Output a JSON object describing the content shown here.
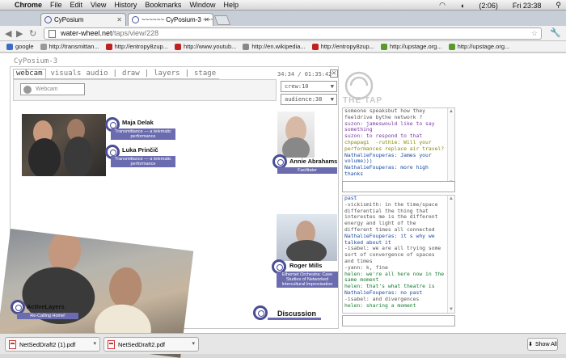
{
  "menubar": {
    "app": "Chrome",
    "items": [
      "File",
      "Edit",
      "View",
      "History",
      "Bookmarks",
      "Window",
      "Help"
    ],
    "battery": "(2:06)",
    "clock": "Fri 23:38"
  },
  "tabs": [
    {
      "title": "CyPosium"
    },
    {
      "title": "~~~~~~ CyPosium-3 ~~~~~~"
    }
  ],
  "toolbar": {
    "url_host": "water-wheel.net",
    "url_path": "/taps/view/228"
  },
  "bookmarks": [
    {
      "label": "google",
      "color": "#3a6cc8"
    },
    {
      "label": "http://transmittan...",
      "color": "#999999"
    },
    {
      "label": "http://entropy8zup...",
      "color": "#c02020"
    },
    {
      "label": "http://www.youtub...",
      "color": "#c02020"
    },
    {
      "label": "http://en.wikipedia...",
      "color": "#888888"
    },
    {
      "label": "http://entropy8zup...",
      "color": "#c02020"
    },
    {
      "label": "http://upstage.org...",
      "color": "#5a9a2a"
    },
    {
      "label": "http://upstage.org...",
      "color": "#5a9a2a"
    }
  ],
  "page": {
    "app_title": "CyPosium-3",
    "stage_tabs": [
      "webcam",
      "visuals",
      "audio",
      "draw",
      "layers",
      "stage"
    ],
    "timer": "34:34 / 01:35:42",
    "webcam_label": "Webcam",
    "crew": "crew:10",
    "audience": "audience:38",
    "brand": "THE TAP"
  },
  "participants": {
    "maja": {
      "name": "Maja Delak",
      "sub": "Transmittance — a telematic performance"
    },
    "luka": {
      "name": "Luka Prinčič",
      "sub": "Transmittance — a telematic performance"
    },
    "annie": {
      "name": "Annie Abrahams",
      "sub": "Facilitator"
    },
    "roger": {
      "name": "Roger Mills",
      "sub": "Ethernet Orchestra: Case Studies of Networked Intercultural Improvisation"
    },
    "active": {
      "name": "ActiveLayers",
      "sub": "Re-Calling Home!"
    },
    "discussion": {
      "name": "Discussion"
    }
  },
  "chat_top": [
    {
      "text": "someone speaksbut how they",
      "color": "gray"
    },
    {
      "text": "feeldrive bythe network ?",
      "color": "gray"
    },
    {
      "text": "suzon: jameswould like to say something",
      "color": "purple"
    },
    {
      "text": "suzon: to respond to that",
      "color": "purple"
    },
    {
      "text": "chpapagi  -ruthie: Will your performances replace air travel?",
      "color": "olive"
    },
    {
      "text": "NathalieFouperas: James your volume)))",
      "color": "blue"
    },
    {
      "text": "NathalieFouperas: more high thanks",
      "color": "blue"
    }
  ],
  "chat_bottom": [
    {
      "text": "past",
      "color": "blue"
    },
    {
      "text": "-vickismith: in the time/space differential the thing that interestes me is the different energy and light of the different times all connected",
      "color": "gray"
    },
    {
      "text": "NathalieFouperas: it s why we talked about it",
      "color": "blue"
    },
    {
      "text": "-isabel: we are all trying some sort of convergence of spaces and times",
      "color": "gray"
    },
    {
      "text": "-yann: k, fine",
      "color": "gray"
    },
    {
      "text": "helen: we're all here now in the same moment",
      "color": "green"
    },
    {
      "text": "helen: that's what theatre is",
      "color": "green"
    },
    {
      "text": "NathalieFouperas: no past",
      "color": "blue"
    },
    {
      "text": "-isabel: and divergences",
      "color": "gray"
    },
    {
      "text": "helen: sharing a moment",
      "color": "green"
    }
  ],
  "downloads": [
    {
      "file": "NetSedDraft2 (1).pdf"
    },
    {
      "file": "NetSedDraft2.pdf"
    }
  ],
  "show_all": "Show All"
}
